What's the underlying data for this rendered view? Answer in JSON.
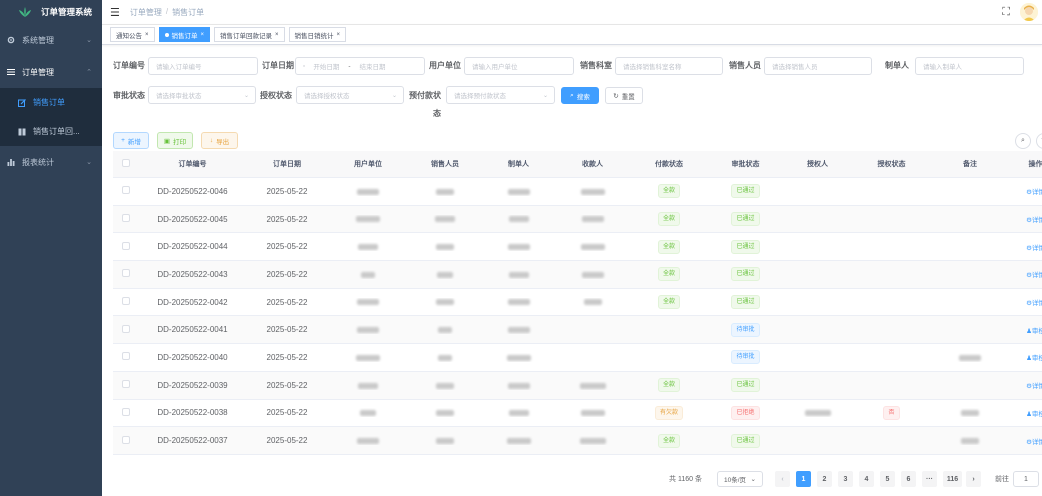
{
  "app": {
    "title": "订单管理系统"
  },
  "sidebar": {
    "items": [
      {
        "label": "系统管理",
        "icon": "gear-icon"
      },
      {
        "label": "订单管理",
        "icon": "list-icon"
      },
      {
        "label": "报表统计",
        "icon": "chart-icon"
      }
    ],
    "sub_items": [
      {
        "label": "销售订单",
        "active": true
      },
      {
        "label": "销售订单回..."
      }
    ]
  },
  "breadcrumb": [
    "订单管理",
    "销售订单"
  ],
  "tags": [
    {
      "label": "通知公告",
      "active": false
    },
    {
      "label": "销售订单",
      "active": true
    },
    {
      "label": "销售订单回款记录",
      "active": false
    },
    {
      "label": "销售日销统计",
      "active": false
    }
  ],
  "search": {
    "order_no": {
      "label": "订单编号",
      "placeholder": "请输入订单编号"
    },
    "order_date": {
      "label": "订单日期",
      "start_placeholder": "开始日期",
      "end_placeholder": "结束日期",
      "range_sep": "-"
    },
    "user_unit": {
      "label": "用户单位",
      "placeholder": "请输入用户单位"
    },
    "sales_dept": {
      "label": "销售科室",
      "placeholder": "请选择销售科室名称"
    },
    "sales_person": {
      "label": "销售人员",
      "placeholder": "请选择销售人员"
    },
    "maker": {
      "label": "制单人",
      "placeholder": "请输入制单人"
    },
    "review_status": {
      "label": "审批状态",
      "placeholder": "请选择审批状态"
    },
    "auth_status": {
      "label": "授权状态",
      "placeholder": "请选择授权状态"
    },
    "prepay_status": {
      "label_line1": "预付款状",
      "label_line2": "态",
      "placeholder": "请选择预付款状态"
    },
    "search_label": "搜索",
    "reset_label": "重置"
  },
  "toolbar": {
    "add_label": "新增",
    "print_label": "打印",
    "export_label": "导出"
  },
  "table": {
    "columns": [
      "订单编号",
      "订单日期",
      "用户单位",
      "销售人员",
      "制单人",
      "收款人",
      "付款状态",
      "审批状态",
      "授权人",
      "授权状态",
      "备注",
      "操作"
    ],
    "rows": [
      {
        "order_no": "DD-20250522-0046",
        "date": "2025-05-22",
        "pay": "全款",
        "pay_type": "success",
        "review": "已通过",
        "review_type": "success",
        "auth": "",
        "op": "详情",
        "op_icon": "gear-icon"
      },
      {
        "order_no": "DD-20250522-0045",
        "date": "2025-05-22",
        "pay": "全款",
        "pay_type": "success",
        "review": "已通过",
        "review_type": "success",
        "auth": "",
        "op": "详情",
        "op_icon": "gear-icon"
      },
      {
        "order_no": "DD-20250522-0044",
        "date": "2025-05-22",
        "pay": "全款",
        "pay_type": "success",
        "review": "已通过",
        "review_type": "success",
        "auth": "",
        "op": "详情",
        "op_icon": "gear-icon"
      },
      {
        "order_no": "DD-20250522-0043",
        "date": "2025-05-22",
        "pay": "全款",
        "pay_type": "success",
        "review": "已通过",
        "review_type": "success",
        "auth": "",
        "op": "详情",
        "op_icon": "gear-icon"
      },
      {
        "order_no": "DD-20250522-0042",
        "date": "2025-05-22",
        "pay": "全款",
        "pay_type": "success",
        "review": "已通过",
        "review_type": "success",
        "auth": "",
        "op": "详情",
        "op_icon": "gear-icon"
      },
      {
        "order_no": "DD-20250522-0041",
        "date": "2025-05-22",
        "pay": "",
        "pay_type": "",
        "review": "待审批",
        "review_type": "info",
        "auth": "",
        "op": "审核",
        "op_icon": "user-icon"
      },
      {
        "order_no": "DD-20250522-0040",
        "date": "2025-05-22",
        "pay": "",
        "pay_type": "",
        "review": "待审批",
        "review_type": "info",
        "auth": "",
        "op": "审核",
        "op_icon": "user-icon"
      },
      {
        "order_no": "DD-20250522-0039",
        "date": "2025-05-22",
        "pay": "全款",
        "pay_type": "success",
        "review": "已通过",
        "review_type": "success",
        "auth": "",
        "op": "详情",
        "op_icon": "gear-icon"
      },
      {
        "order_no": "DD-20250522-0038",
        "date": "2025-05-22",
        "pay": "有欠款",
        "pay_type": "warning",
        "review": "已拒绝",
        "review_type": "danger",
        "auth": "否",
        "op": "审核",
        "op_icon": "user-icon"
      },
      {
        "order_no": "DD-20250522-0037",
        "date": "2025-05-22",
        "pay": "全款",
        "pay_type": "success",
        "review": "已通过",
        "review_type": "success",
        "auth": "",
        "op": "详情",
        "op_icon": "gear-icon"
      }
    ]
  },
  "pagination": {
    "total": "共 1160 条",
    "page_size": "10条/页",
    "pages": [
      "1",
      "2",
      "3",
      "4",
      "5",
      "6"
    ],
    "ellipsis": "···",
    "last": "116",
    "current": "1",
    "jump_label": "前往",
    "jump_value": "1",
    "prev": "‹",
    "next": "›"
  },
  "colors": {
    "primary": "#409eff",
    "sidebar_bg": "#304156",
    "submenu_bg": "#1f2d3d"
  }
}
